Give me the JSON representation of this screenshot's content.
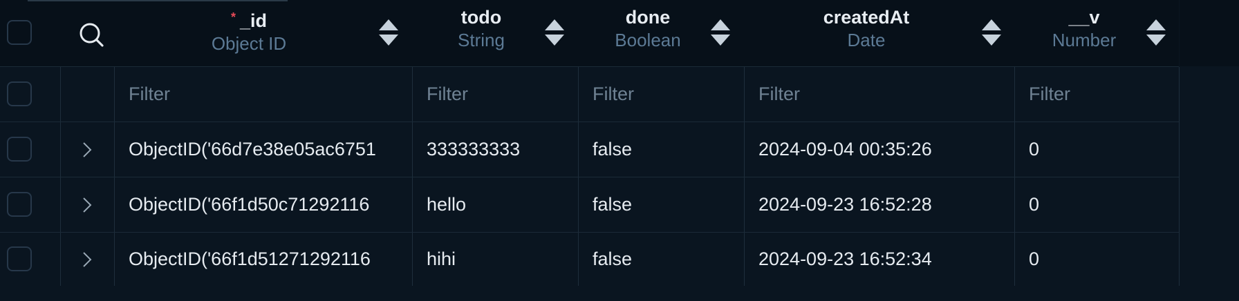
{
  "header": {
    "columns": [
      {
        "name": "_id",
        "type": "Object ID",
        "required": "*"
      },
      {
        "name": "todo",
        "type": "String"
      },
      {
        "name": "done",
        "type": "Boolean"
      },
      {
        "name": "createdAt",
        "type": "Date"
      },
      {
        "name": "__v",
        "type": "Number"
      }
    ]
  },
  "filter_row": {
    "placeholder": "Filter"
  },
  "rows": [
    {
      "_id": "ObjectID('66d7e38e05ac6751",
      "todo": "333333333",
      "done": "false",
      "createdAt": "2024-09-04 00:35:26",
      "__v": "0"
    },
    {
      "_id": "ObjectID('66f1d50c71292116",
      "todo": "hello",
      "done": "false",
      "createdAt": "2024-09-23 16:52:28",
      "__v": "0"
    },
    {
      "_id": "ObjectID('66f1d51271292116",
      "todo": "hihi",
      "done": "false",
      "createdAt": "2024-09-23 16:52:34",
      "__v": "0"
    }
  ],
  "icons": {
    "search": "search-icon",
    "expand": "chevron-right-icon",
    "sort": "sort-icon"
  },
  "colors": {
    "background": "#0a1520",
    "header_background": "#071019",
    "required_star": "#e64a57",
    "type_text": "#5c7a95",
    "filter_text": "#6f8293"
  }
}
